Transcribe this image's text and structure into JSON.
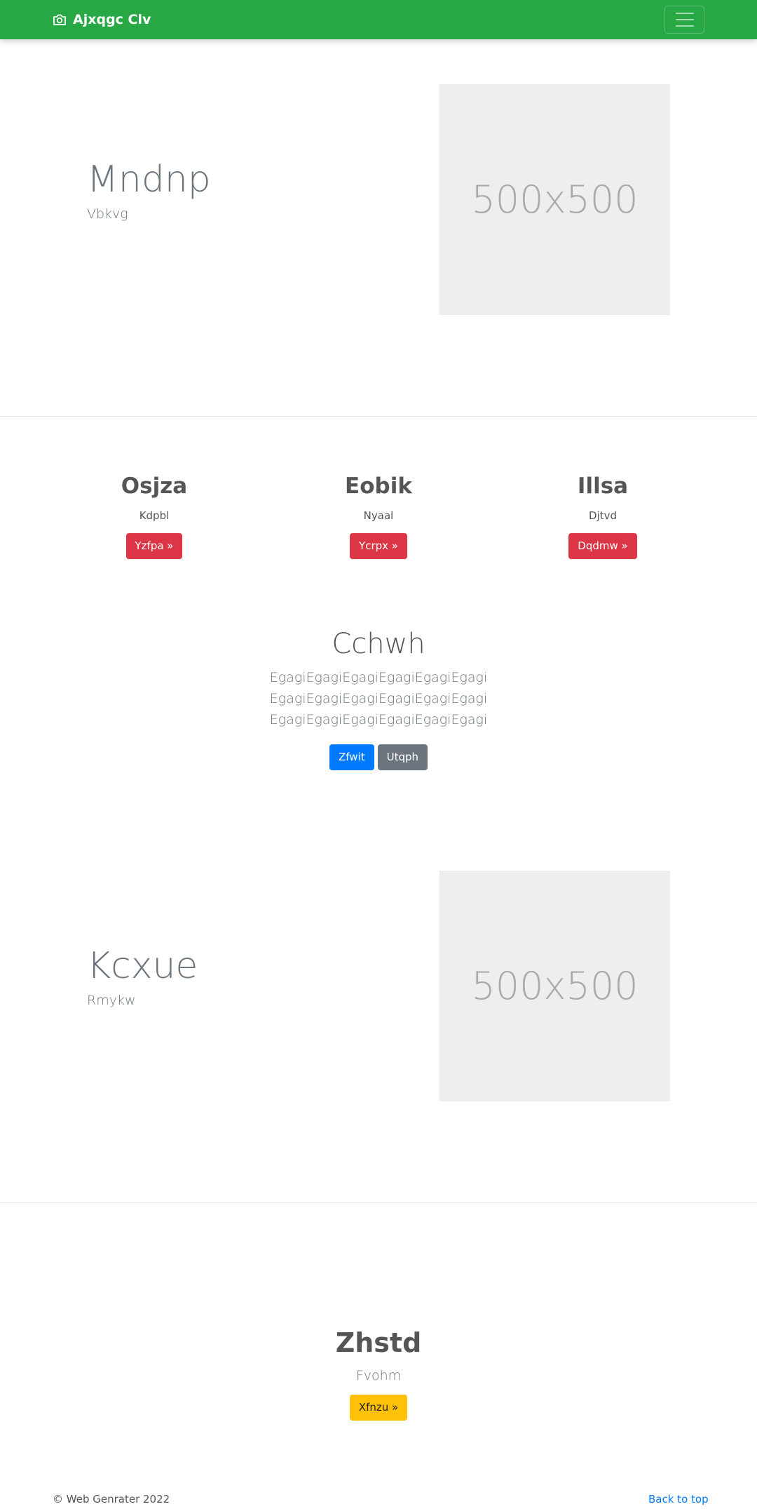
{
  "navbar": {
    "brand": "Ajxqgc Clv",
    "brand_icon": "camera-icon",
    "toggler_icon": "hamburger-icon",
    "color": "#28a745"
  },
  "feature1": {
    "title": "Mndnp",
    "subtitle": "Vbkvg",
    "image_text": "500x500"
  },
  "columns": [
    {
      "title": "Osjza",
      "text": "Kdpbl",
      "button": "Yzfpa »"
    },
    {
      "title": "Eobik",
      "text": "Nyaal",
      "button": "Ycrpx »"
    },
    {
      "title": "Illsa",
      "text": "Djtvd",
      "button": "Dqdmw »"
    }
  ],
  "cta": {
    "title": "Cchwh",
    "text": "EgagiEgagiEgagiEgagiEgagiEgagi EgagiEgagiEgagiEgagiEgagiEgagi EgagiEgagiEgagiEgagiEgagiEgagi",
    "primary_button": "Zfwit",
    "secondary_button": "Utqph"
  },
  "feature2": {
    "title": "Kcxue",
    "subtitle": "Rmykw",
    "image_text": "500x500"
  },
  "bottom": {
    "title": "Zhstd",
    "subtitle": "Fvohm",
    "button": "Xfnzu »"
  },
  "footer": {
    "copyright": "© Web Genrater 2022",
    "back_to_top": "Back to top"
  },
  "colors": {
    "danger": "#dc3545",
    "primary": "#007bff",
    "secondary": "#6c757d",
    "warning": "#ffc107"
  }
}
